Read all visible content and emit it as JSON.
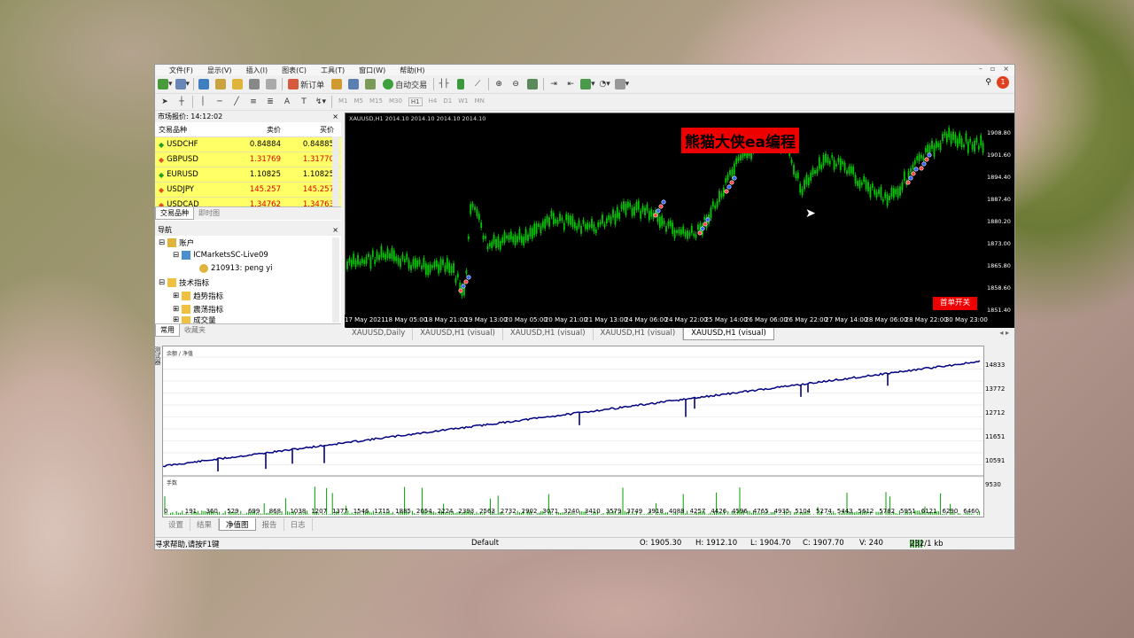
{
  "menu": [
    "文件(F)",
    "显示(V)",
    "插入(I)",
    "图表(C)",
    "工具(T)",
    "窗口(W)",
    "帮助(H)"
  ],
  "window_controls": [
    "–",
    "▫",
    "×"
  ],
  "toolbar": {
    "new_order": "新订单",
    "auto_trading": "自动交易",
    "timeframes": [
      "M1",
      "M5",
      "M15",
      "M30",
      "H1",
      "H4",
      "D1",
      "W1",
      "MN"
    ],
    "active_timeframe": "H1",
    "notification_count": "1"
  },
  "market_watch": {
    "title": "市场报价: 14:12:02",
    "columns": [
      "交易品种",
      "卖价",
      "买价"
    ],
    "rows": [
      {
        "symbol": "USDCHF",
        "bid": "0.84884",
        "ask": "0.84885",
        "dir": "up"
      },
      {
        "symbol": "GBPUSD",
        "bid": "1.31769",
        "ask": "1.31770",
        "dir": "down"
      },
      {
        "symbol": "EURUSD",
        "bid": "1.10825",
        "ask": "1.10825",
        "dir": "up"
      },
      {
        "symbol": "USDJPY",
        "bid": "145.257",
        "ask": "145.257",
        "dir": "down"
      },
      {
        "symbol": "USDCAD",
        "bid": "1.34762",
        "ask": "1.34763",
        "dir": "down"
      }
    ],
    "tabs": [
      "交易品种",
      "即时图"
    ]
  },
  "navigator": {
    "title": "导航",
    "items": [
      "账户",
      "ICMarketsSC-Live09",
      "210913: peng yi",
      "技术指标",
      "趋势指标",
      "震荡指标",
      "成交量"
    ],
    "tabs": [
      "常用",
      "收藏夹"
    ]
  },
  "chart": {
    "info": "XAUUSD,H1  2014.10 2014.10 2014.10 2014.10",
    "overlay_label": "熊猫大侠ea编程",
    "button_label": "首单开关",
    "y_ticks": [
      "1908.80",
      "1901.60",
      "1894.40",
      "1887.40",
      "1880.20",
      "1873.00",
      "1865.80",
      "1858.60",
      "1851.40"
    ],
    "x_ticks": [
      "17 May 2021",
      "18 May 05:00",
      "18 May 21:00",
      "19 May 13:00",
      "20 May 05:00",
      "20 May 21:00",
      "21 May 13:00",
      "24 May 06:00",
      "24 May 22:00",
      "25 May 14:00",
      "26 May 06:00",
      "26 May 22:00",
      "27 May 14:00",
      "28 May 06:00",
      "28 May 22:00",
      "30 May 23:00"
    ],
    "colors": {
      "up": "#00c800",
      "down": "#00c800",
      "bg": "#000000"
    }
  },
  "chart_tabs": [
    "XAUUSD,Daily",
    "XAUUSD,H1 (visual)",
    "XAUUSD,H1 (visual)",
    "XAUUSD,H1 (visual)",
    "XAUUSD,H1 (visual)"
  ],
  "active_chart_tab": 4,
  "tester": {
    "balance_label": "余额 / 净值",
    "lots_label": "手数",
    "y_ticks": [
      "14833",
      "13772",
      "12712",
      "11651",
      "10591",
      "9530"
    ],
    "x_ticks": [
      "0",
      "191",
      "360",
      "529",
      "699",
      "868",
      "1038",
      "1207",
      "1377",
      "1546",
      "1715",
      "1885",
      "2054",
      "2224",
      "2393",
      "2563",
      "2732",
      "2902",
      "3071",
      "3240",
      "3410",
      "3579",
      "3749",
      "3918",
      "4088",
      "4257",
      "4426",
      "4596",
      "4765",
      "4935",
      "5104",
      "5274",
      "5443",
      "5612",
      "5782",
      "5951",
      "6121",
      "6290",
      "6460"
    ],
    "tabs": [
      "设置",
      "结果",
      "净值图",
      "报告",
      "日志"
    ],
    "active_tab": 2,
    "colors": {
      "balance": "#000080",
      "lots": "#00a000"
    }
  },
  "side_label": "测试器",
  "status_bar": {
    "help": "寻求帮助,请按F1键",
    "profile": "Default",
    "open": "O: 1905.30",
    "high": "H: 1912.10",
    "low": "L: 1904.70",
    "close": "C: 1907.70",
    "volume": "V: 240",
    "traffic": "232/1 kb"
  }
}
